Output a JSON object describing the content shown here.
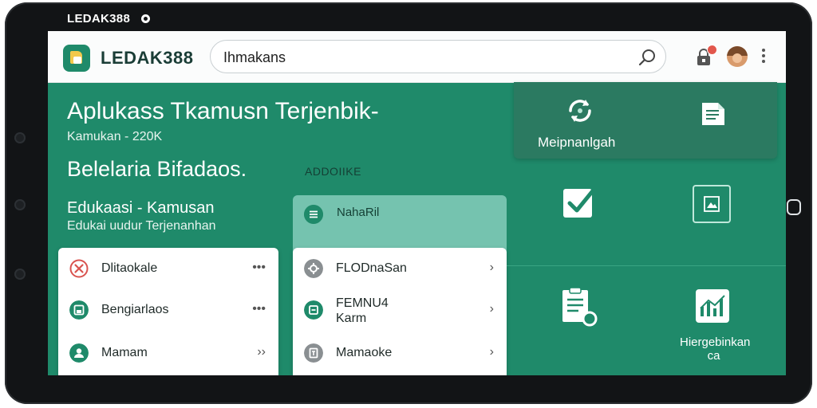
{
  "status_bar": {
    "title": "LEDAK388"
  },
  "app_bar": {
    "brand": "LEDAK388",
    "search_value": "Ihmakans",
    "icons": [
      "search-icon",
      "lock-icon",
      "avatar",
      "kebab-menu-icon"
    ]
  },
  "hero": {
    "title": "Aplukass Tkamusn Terjenbik-",
    "subtitle": "Kamukan - 220K"
  },
  "section": {
    "title": "Belelaria Bifadaos.",
    "label": "ADDOIIKE"
  },
  "edukasi": {
    "title": "Edukaasi - Kamusan",
    "subtitle": "Edukai uudur Terjenanhan"
  },
  "left_list": [
    {
      "label": "Dlitaokale",
      "icon": "close-icon",
      "trail": "•••"
    },
    {
      "label": "Bengiarlaos",
      "icon": "save-icon",
      "trail": "•••"
    },
    {
      "label": "Mamam",
      "icon": "user-icon",
      "trail": "››"
    }
  ],
  "tab": {
    "label": "NahaRil"
  },
  "mid_list": [
    {
      "label": "FLODnaSan",
      "icon": "gear-icon",
      "trail": "›"
    },
    {
      "label": "FEMNU4",
      "label2": "Karm",
      "icon": "card-icon",
      "trail": "›"
    },
    {
      "label": "Mamaoke",
      "icon": "calculator-icon",
      "trail": "›"
    }
  ],
  "right_tiles": {
    "top": {
      "label": "Meipnanlgah"
    },
    "bottom": {
      "label": "Hiergebinkan",
      "label2": "ca"
    }
  },
  "colors": {
    "primary": "#1f8a6a",
    "panel": "#2b7a61",
    "tab": "#75c3af",
    "appbar": "#fbfcfc"
  }
}
